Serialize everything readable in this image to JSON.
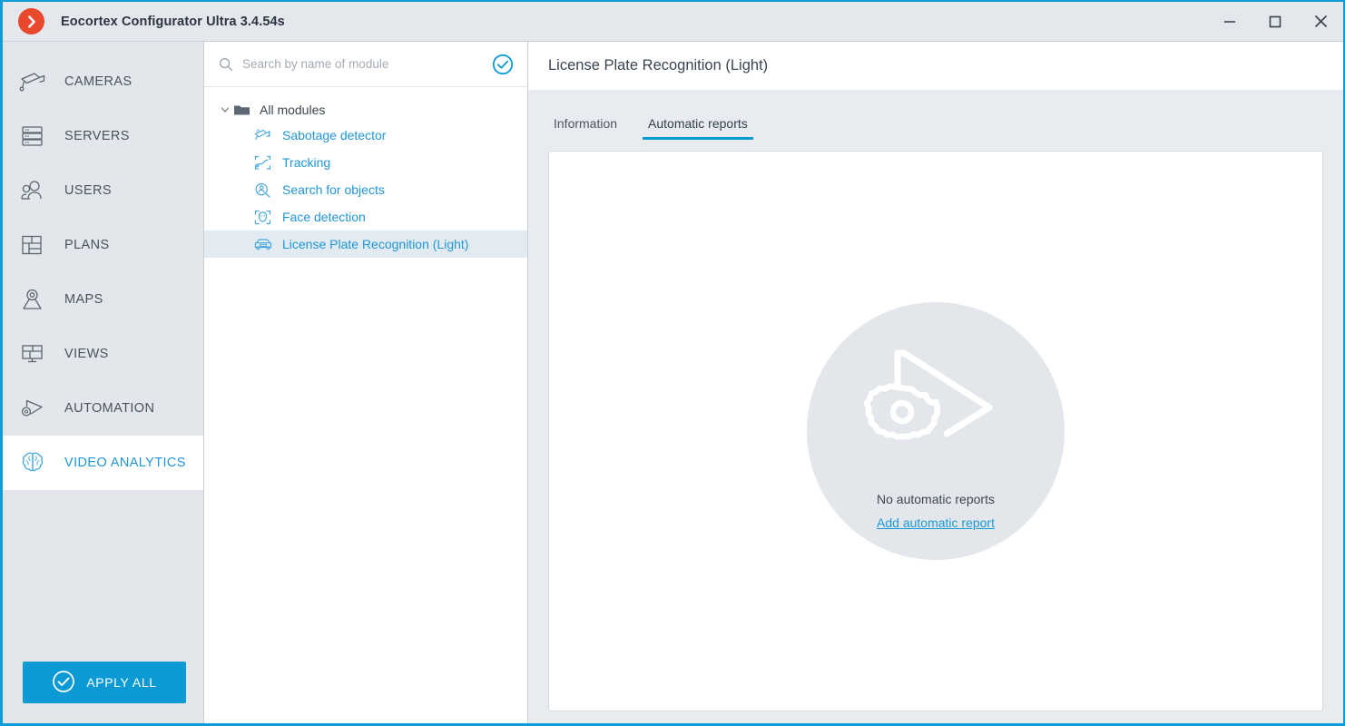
{
  "window": {
    "title": "Eocortex Configurator Ultra 3.4.54s",
    "logo_icon": "chevron-right-circle-icon",
    "minimize_label": "–",
    "maximize_label": "□",
    "close_label": "✕",
    "accent_color": "#0c9ad5",
    "logo_color": "#e8492c"
  },
  "sidebar": {
    "items": [
      {
        "label": "CAMERAS",
        "icon": "camera-icon",
        "active": false
      },
      {
        "label": "SERVERS",
        "icon": "servers-icon",
        "active": false
      },
      {
        "label": "USERS",
        "icon": "users-icon",
        "active": false
      },
      {
        "label": "PLANS",
        "icon": "plans-icon",
        "active": false
      },
      {
        "label": "MAPS",
        "icon": "map-pin-icon",
        "active": false
      },
      {
        "label": "VIEWS",
        "icon": "views-grid-icon",
        "active": false
      },
      {
        "label": "AUTOMATION",
        "icon": "automation-gear-play-icon",
        "active": false
      },
      {
        "label": "VIDEO ANALYTICS",
        "icon": "brain-icon",
        "active": true
      }
    ],
    "apply_all": {
      "label": "APPLY ALL",
      "icon": "check-circle-icon"
    }
  },
  "tree_panel": {
    "search": {
      "placeholder": "Search by name of module",
      "value": "",
      "icon": "search-icon",
      "confirm_icon": "check-circle-icon"
    },
    "root": {
      "label": "All modules",
      "icon": "folder-icon",
      "expand_icon": "chevron-down-icon",
      "expanded": true
    },
    "modules": [
      {
        "label": "Sabotage detector",
        "icon": "sabotage-detector-icon",
        "selected": false
      },
      {
        "label": "Tracking",
        "icon": "tracking-icon",
        "selected": false
      },
      {
        "label": "Search for objects",
        "icon": "search-objects-icon",
        "selected": false
      },
      {
        "label": "Face detection",
        "icon": "face-detection-icon",
        "selected": false
      },
      {
        "label": "License Plate Recognition (Light)",
        "icon": "license-plate-icon",
        "selected": true
      }
    ]
  },
  "main": {
    "title": "License Plate Recognition (Light)",
    "tabs": [
      {
        "label": "Information",
        "active": false
      },
      {
        "label": "Automatic reports",
        "active": true
      }
    ],
    "empty_state": {
      "icon": "automation-gear-play-icon",
      "message": "No automatic reports",
      "action_link": "Add automatic report"
    }
  }
}
